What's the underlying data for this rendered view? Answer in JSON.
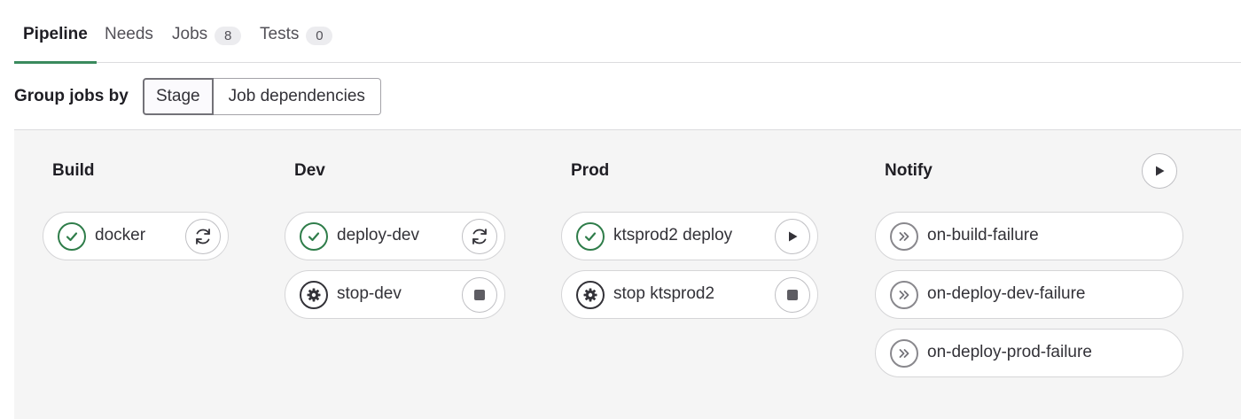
{
  "tabs": [
    {
      "label": "Pipeline",
      "active": true
    },
    {
      "label": "Needs",
      "active": false
    },
    {
      "label": "Jobs",
      "count": "8",
      "active": false
    },
    {
      "label": "Tests",
      "count": "0",
      "active": false
    }
  ],
  "group_by": {
    "label": "Group jobs by",
    "options": [
      "Stage",
      "Job dependencies"
    ],
    "selected": "Stage"
  },
  "stages": [
    {
      "title": "Build",
      "jobs": [
        {
          "name": "docker",
          "status": "success",
          "status_icon": "check-circle-icon",
          "action_icon": "retry-icon"
        }
      ]
    },
    {
      "title": "Dev",
      "jobs": [
        {
          "name": "deploy-dev",
          "status": "success",
          "status_icon": "check-circle-icon",
          "action_icon": "retry-icon"
        },
        {
          "name": "stop-dev",
          "status": "manual",
          "status_icon": "gear-icon",
          "action_icon": "stop-icon"
        }
      ]
    },
    {
      "title": "Prod",
      "jobs": [
        {
          "name": "ktsprod2 deploy",
          "status": "success",
          "status_icon": "check-circle-icon",
          "action_icon": "play-icon"
        },
        {
          "name": "stop ktsprod2",
          "status": "manual",
          "status_icon": "gear-icon",
          "action_icon": "stop-icon"
        }
      ]
    },
    {
      "title": "Notify",
      "stage_action_icon": "play-icon",
      "jobs": [
        {
          "name": "on-build-failure",
          "status": "skipped",
          "status_icon": "skipped-icon"
        },
        {
          "name": "on-deploy-dev-failure",
          "status": "skipped",
          "status_icon": "skipped-icon"
        },
        {
          "name": "on-deploy-prod-failure",
          "status": "skipped",
          "status_icon": "skipped-icon"
        }
      ]
    }
  ],
  "colors": {
    "success": "#2f7d4a",
    "active_tab_underline": "#3a8a5d",
    "graph_background": "#f5f5f5"
  }
}
